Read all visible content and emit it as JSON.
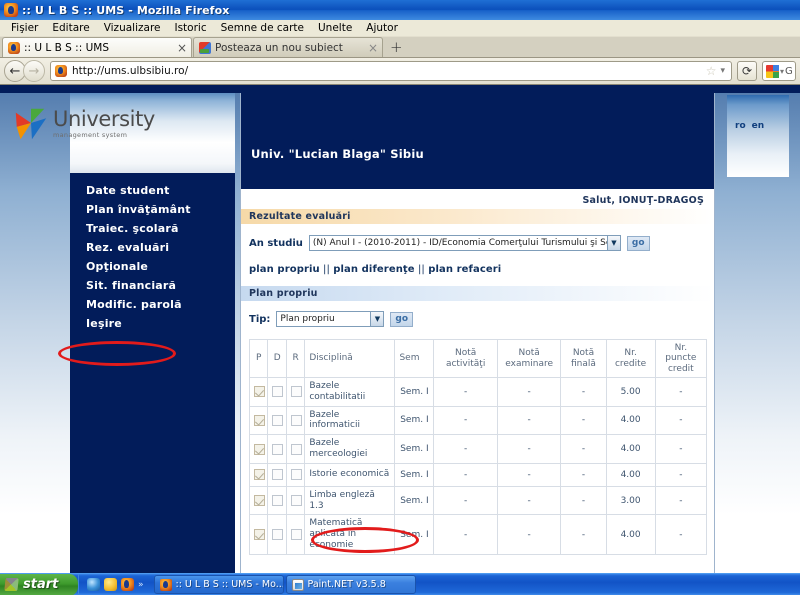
{
  "window": {
    "title": ":: U L B S :: UMS - Mozilla Firefox",
    "icon": "firefox-icon"
  },
  "menubar": {
    "items": [
      {
        "label": "Fişier"
      },
      {
        "label": "Editare"
      },
      {
        "label": "Vizualizare"
      },
      {
        "label": "Istoric"
      },
      {
        "label": "Semne de carte"
      },
      {
        "label": "Unelte"
      },
      {
        "label": "Ajutor"
      }
    ]
  },
  "tabs": [
    {
      "label": ":: U L B S :: UMS",
      "favicon": "firefox-icon",
      "active": true,
      "close": "×"
    },
    {
      "label": "Posteaza un nou subiect",
      "favicon": "forum-icon",
      "active": false,
      "close": "×"
    }
  ],
  "newtab_label": "+",
  "navbar": {
    "back_icon": "←",
    "forward_icon": "→",
    "url": "http://ums.ulbsibiu.ro/",
    "star_icon": "☆",
    "dropdown_caret": "▾",
    "reload_icon": "⟳",
    "search_engine": "google-icon",
    "search_caret": "▾",
    "search_hint": "G"
  },
  "page": {
    "logo": {
      "title": "University",
      "subtitle": "management system"
    },
    "sidebar": {
      "items": [
        {
          "label": "Date student"
        },
        {
          "label": "Plan învăţământ"
        },
        {
          "label": "Traiec. şcolară"
        },
        {
          "label": "Rez. evaluări"
        },
        {
          "label": "Opţionale"
        },
        {
          "label": "Sit. financiară"
        },
        {
          "label": "Modific. parolă"
        },
        {
          "label": "Ieşire"
        }
      ]
    },
    "lang": {
      "ro": "ro",
      "en": "en"
    },
    "university": "Univ. \"Lucian Blaga\" Sibiu",
    "greeting": "Salut, IONUŢ-DRAGOŞ",
    "section_results": "Rezultate evaluări",
    "an_studiu": {
      "label": "An studiu",
      "value": "(N) Anul I - (2010-2011) - ID/Economia Comerţului Turismului şi Se",
      "go": "go"
    },
    "plan_links": {
      "propriu": "plan propriu",
      "sep1": " || ",
      "diferente": "plan diferenţe",
      "sep2": " || ",
      "refaceri": "plan refaceri"
    },
    "section_plan": "Plan propriu",
    "tip": {
      "label": "Tip:",
      "value": "Plan propriu",
      "go": "go"
    },
    "table": {
      "columns": [
        "P",
        "D",
        "R",
        "Disciplină",
        "Sem",
        "Notă activităţi",
        "Notă examinare",
        "Notă finală",
        "Nr. credite",
        "Nr. puncte credit"
      ],
      "rows": [
        {
          "p": true,
          "d": false,
          "r": false,
          "disciplina": "Bazele contabilitatii",
          "sem": "Sem. I",
          "nota_activitati": "-",
          "nota_examinare": "-",
          "nota_finala": "-",
          "nr_credite": "5.00",
          "nr_puncte_credit": "-"
        },
        {
          "p": true,
          "d": false,
          "r": false,
          "disciplina": "Bazele informaticii",
          "sem": "Sem. I",
          "nota_activitati": "-",
          "nota_examinare": "-",
          "nota_finala": "-",
          "nr_credite": "4.00",
          "nr_puncte_credit": "-"
        },
        {
          "p": true,
          "d": false,
          "r": false,
          "disciplina": "Bazele merceologiei",
          "sem": "Sem. I",
          "nota_activitati": "-",
          "nota_examinare": "-",
          "nota_finala": "-",
          "nr_credite": "4.00",
          "nr_puncte_credit": "-"
        },
        {
          "p": true,
          "d": false,
          "r": false,
          "disciplina": "Istorie economică",
          "sem": "Sem. I",
          "nota_activitati": "-",
          "nota_examinare": "-",
          "nota_finala": "-",
          "nr_credite": "4.00",
          "nr_puncte_credit": "-"
        },
        {
          "p": true,
          "d": false,
          "r": false,
          "disciplina": "Limba engleză 1.3",
          "sem": "Sem. I",
          "nota_activitati": "-",
          "nota_examinare": "-",
          "nota_finala": "-",
          "nr_credite": "3.00",
          "nr_puncte_credit": "-"
        },
        {
          "p": true,
          "d": false,
          "r": false,
          "disciplina": "Matematică aplicată in economie",
          "sem": "Sem. I",
          "nota_activitati": "-",
          "nota_examinare": "-",
          "nota_finala": "-",
          "nr_credite": "4.00",
          "nr_puncte_credit": "-"
        }
      ]
    }
  },
  "annotations": {
    "color": "#e21b1b",
    "ellipse_nav_target": "Rez. evaluări",
    "ellipse_discipline_target": "Bazele informaticii"
  },
  "taskbar": {
    "start": "start",
    "quicklaunch_more": "»",
    "buttons": [
      {
        "label": ":: U L B S :: UMS - Mo...",
        "icon": "firefox-icon"
      },
      {
        "label": "Paint.NET v3.5.8",
        "icon": "paintnet-icon"
      }
    ]
  }
}
